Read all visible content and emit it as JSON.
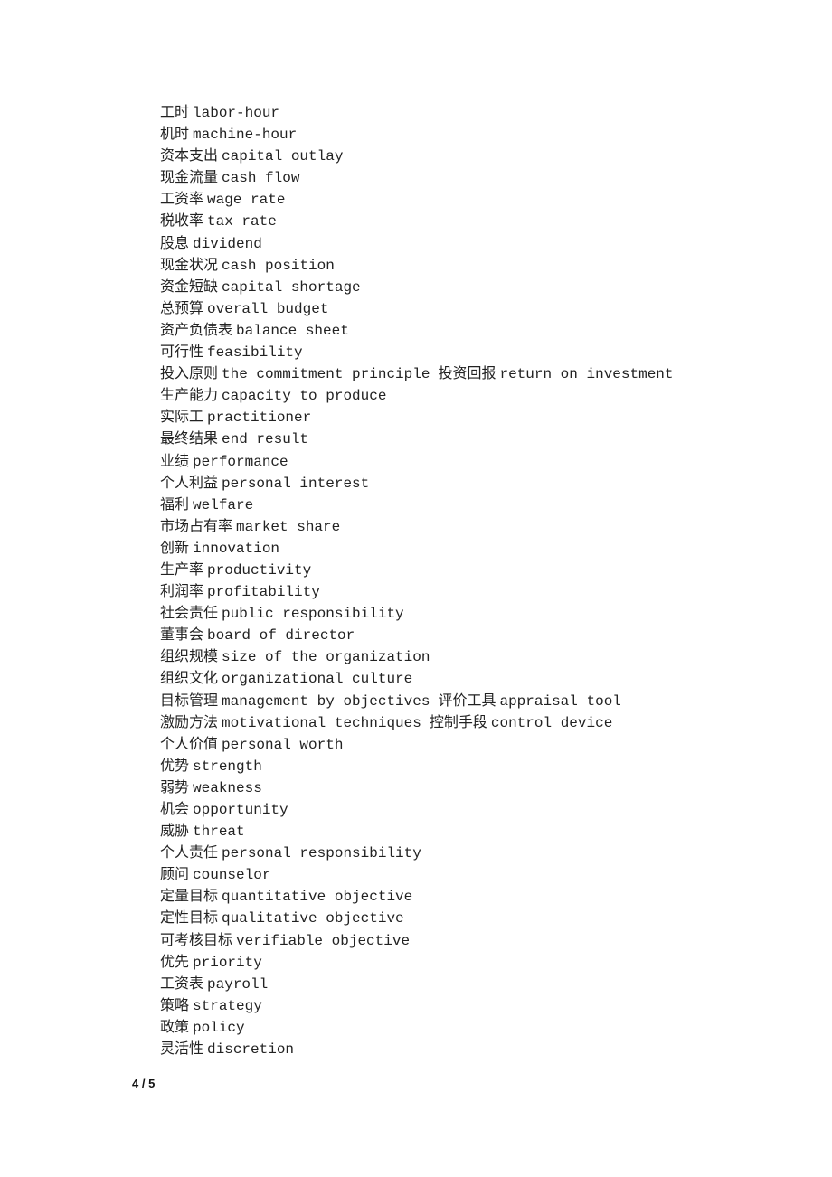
{
  "entries": [
    [
      {
        "zh": "工时",
        "en": "labor-hour"
      }
    ],
    [
      {
        "zh": "机时",
        "en": "machine-hour"
      }
    ],
    [
      {
        "zh": "资本支出",
        "en": "capital outlay"
      }
    ],
    [
      {
        "zh": "现金流量",
        "en": "cash flow"
      }
    ],
    [
      {
        "zh": "工资率",
        "en": "wage rate"
      }
    ],
    [
      {
        "zh": "税收率",
        "en": "tax rate"
      }
    ],
    [
      {
        "zh": "股息",
        "en": "dividend"
      }
    ],
    [
      {
        "zh": "现金状况",
        "en": "cash position"
      }
    ],
    [
      {
        "zh": "资金短缺",
        "en": "capital shortage"
      }
    ],
    [
      {
        "zh": "总预算",
        "en": "overall budget"
      }
    ],
    [
      {
        "zh": "资产负债表",
        "en": "balance sheet"
      }
    ],
    [
      {
        "zh": "可行性",
        "en": "feasibility"
      }
    ],
    [
      {
        "zh": "投入原则",
        "en": "the commitment principle"
      },
      {
        "zh": "投资回报",
        "en": "return on investment"
      }
    ],
    [
      {
        "zh": "生产能力",
        "en": "capacity to produce"
      }
    ],
    [
      {
        "zh": "实际工",
        "en": "practitioner"
      }
    ],
    [
      {
        "zh": "最终结果",
        "en": "end result"
      }
    ],
    [
      {
        "zh": "业绩",
        "en": "performance"
      }
    ],
    [
      {
        "zh": "个人利益",
        "en": "personal interest"
      }
    ],
    [
      {
        "zh": "福利",
        "en": "welfare"
      }
    ],
    [
      {
        "zh": "市场占有率",
        "en": "market share"
      }
    ],
    [
      {
        "zh": "创新",
        "en": "innovation"
      }
    ],
    [
      {
        "zh": "生产率",
        "en": "productivity"
      }
    ],
    [
      {
        "zh": "利润率",
        "en": "profitability"
      }
    ],
    [
      {
        "zh": "社会责任",
        "en": "public responsibility"
      }
    ],
    [
      {
        "zh": "董事会",
        "en": "board of director"
      }
    ],
    [
      {
        "zh": "组织规模",
        "en": "size of the organization"
      }
    ],
    [
      {
        "zh": "组织文化",
        "en": "organizational culture"
      }
    ],
    [
      {
        "zh": "目标管理",
        "en": "management by objectives"
      },
      {
        "zh": "评价工具",
        "en": "appraisal tool"
      }
    ],
    [
      {
        "zh": "激励方法",
        "en": "motivational techniques"
      },
      {
        "zh": "控制手段",
        "en": "control device"
      }
    ],
    [
      {
        "zh": "个人价值",
        "en": "personal worth"
      }
    ],
    [
      {
        "zh": "优势",
        "en": "strength"
      }
    ],
    [
      {
        "zh": "弱势",
        "en": "weakness"
      }
    ],
    [
      {
        "zh": "机会",
        "en": "opportunity"
      }
    ],
    [
      {
        "zh": "威胁",
        "en": "threat"
      }
    ],
    [
      {
        "zh": "个人责任",
        "en": "personal responsibility"
      }
    ],
    [
      {
        "zh": "顾问",
        "en": "counselor"
      }
    ],
    [
      {
        "zh": "定量目标",
        "en": "quantitative objective"
      }
    ],
    [
      {
        "zh": "定性目标",
        "en": "qualitative objective"
      }
    ],
    [
      {
        "zh": "可考核目标",
        "en": "verifiable objective"
      }
    ],
    [
      {
        "zh": "优先",
        "en": "priority"
      }
    ],
    [
      {
        "zh": "工资表",
        "en": "payroll"
      }
    ],
    [
      {
        "zh": "策略",
        "en": "strategy"
      }
    ],
    [
      {
        "zh": "政策",
        "en": "policy"
      }
    ],
    [
      {
        "zh": "灵活性",
        "en": "discretion"
      }
    ]
  ],
  "footer": {
    "page_number": "4 / 5"
  }
}
